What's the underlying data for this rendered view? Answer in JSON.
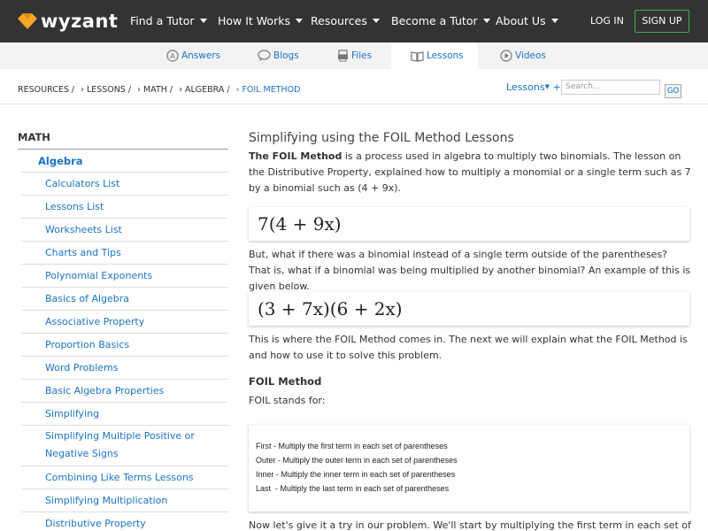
{
  "brand": {
    "logo_text": "wyzant"
  },
  "nav": {
    "items": [
      "Find a Tutor",
      "How It Works",
      "Resources",
      "Become a Tutor",
      "About Us"
    ],
    "login": "LOG IN",
    "signup": "SIGN UP"
  },
  "tabs": [
    "Answers",
    "Blogs",
    "Files",
    "Lessons",
    "Videos"
  ],
  "breadcrumb": [
    "RESOURCES /",
    "› LESSONS /",
    "› MATH /",
    "› ALGEBRA /",
    "› FOIL METHOD"
  ],
  "search": {
    "dropdown": "Lessons",
    "plus": "+",
    "placeholder": "Search...",
    "go": "GO"
  },
  "sidebar": {
    "heading": "MATH",
    "subheading": "Algebra",
    "items": [
      "Calculators List",
      "Lessons List",
      "Worksheets List",
      "Charts and Tips",
      "Polynomial Exponents",
      "Basics of Algebra",
      "Associative Property",
      "Proportion Basics",
      "Word Problems",
      "Basic Algebra Properties",
      "Simplifying",
      "Simplifying Multiple Positive or Negative Signs",
      "Combining Like Terms Lessons",
      "Simplifying Multiplication",
      "Distributive Property"
    ]
  },
  "main": {
    "title": "Simplifying using the FOIL Method Lessons",
    "intro_bold": "The FOIL Method",
    "intro_rest": " is a process used in algebra to multiply two binomials. The lesson on the Distributive Property, explained how to multiply a monomial or a single term such as 7 by a binomial such as (4 + 9x).",
    "math1": "7(4 + 9x)",
    "para2": "But, what if there was a binomial instead of a single term outside of the parentheses? That is, what if a binomial was being multiplied by another binomial? An example of this is given below.",
    "math2": "(3 + 7x)(6 + 2x)",
    "para3": "This is where the FOIL Method comes in. The next we will explain what the FOIL Method is and how to use it to solve this problem.",
    "foil_heading": "FOIL Method",
    "foil_stands": "FOIL stands for:",
    "foil_lines": [
      {
        "key": "First",
        "text": " - Multiply the first term in each set of parentheses"
      },
      {
        "key": "Outer",
        "text": " - Multiply the outer term in each set of parentheses"
      },
      {
        "key": "Inner",
        "text": " - Multiply the inner term in each set of parentheses"
      },
      {
        "key": "Last",
        "text": "  - Multiply the last term in each set of parentheses"
      }
    ],
    "para4": "Now let's give it a try in our problem. We'll start by multiplying the first term in each set of"
  }
}
